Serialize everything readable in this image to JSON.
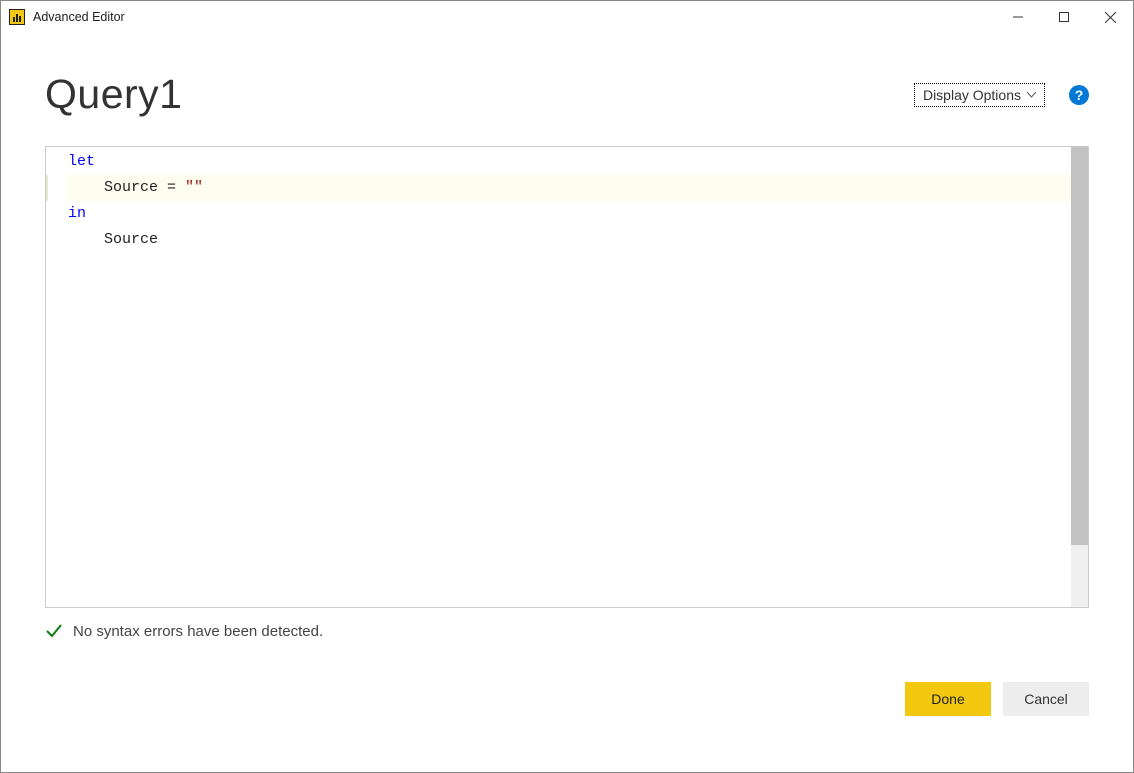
{
  "titlebar": {
    "title": "Advanced Editor"
  },
  "header": {
    "query_name": "Query1",
    "display_options_label": "Display Options",
    "help_glyph": "?"
  },
  "code": {
    "kw_let": "let",
    "line2_pre": "    Source = ",
    "line2_str": "\"\"",
    "kw_in": "in",
    "line4": "    Source"
  },
  "status": {
    "message": "No syntax errors have been detected."
  },
  "buttons": {
    "done": "Done",
    "cancel": "Cancel"
  }
}
